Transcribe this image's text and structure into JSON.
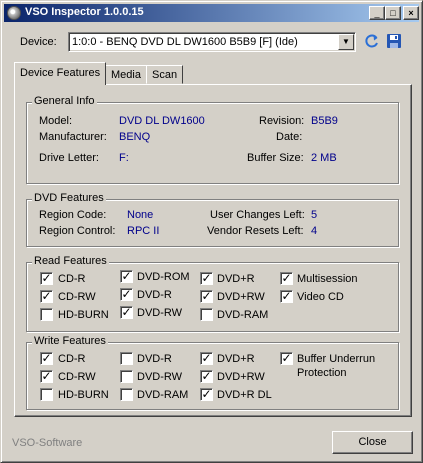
{
  "window": {
    "title": "VSO Inspector 1.0.0.15",
    "minimize_glyph": "_",
    "maximize_glyph": "□",
    "close_glyph": "×"
  },
  "device": {
    "label": "Device:",
    "selected": "1:0:0 - BENQ DVD DL DW1600 B5B9 [F] (Ide)",
    "dropdown_glyph": "▼"
  },
  "tabs": [
    "Device Features",
    "Media",
    "Scan"
  ],
  "general_info": {
    "title": "General Info",
    "model_label": "Model:",
    "model_value": "DVD DL DW1600",
    "revision_label": "Revision:",
    "revision_value": "B5B9",
    "manufacturer_label": "Manufacturer:",
    "manufacturer_value": "BENQ",
    "date_label": "Date:",
    "date_value": "",
    "drive_letter_label": "Drive Letter:",
    "drive_letter_value": "F:",
    "buffer_size_label": "Buffer Size:",
    "buffer_size_value": "2 MB"
  },
  "dvd_features": {
    "title": "DVD Features",
    "region_code_label": "Region Code:",
    "region_code_value": "None",
    "user_changes_label": "User Changes Left:",
    "user_changes_value": "5",
    "region_control_label": "Region Control:",
    "region_control_value": "RPC II",
    "vendor_resets_label": "Vendor Resets Left:",
    "vendor_resets_value": "4"
  },
  "read_features": {
    "title": "Read Features",
    "items": [
      {
        "label": "CD-R",
        "checked": true
      },
      {
        "label": "DVD-ROM",
        "checked": true
      },
      {
        "label": "DVD+R",
        "checked": true
      },
      {
        "label": "Multisession",
        "checked": true
      },
      {
        "label": "CD-RW",
        "checked": true
      },
      {
        "label": "DVD-R",
        "checked": true
      },
      {
        "label": "DVD+RW",
        "checked": true
      },
      {
        "label": "Video CD",
        "checked": true
      },
      {
        "label": "HD-BURN",
        "checked": false
      },
      {
        "label": "DVD-RW",
        "checked": true
      },
      {
        "label": "DVD-RAM",
        "checked": false
      }
    ]
  },
  "write_features": {
    "title": "Write Features",
    "items": [
      {
        "label": "CD-R",
        "checked": true
      },
      {
        "label": "DVD-R",
        "checked": false
      },
      {
        "label": "DVD+R",
        "checked": true
      },
      {
        "label": "Buffer Underrun",
        "label2": "Protection",
        "checked": true
      },
      {
        "label": "CD-RW",
        "checked": true
      },
      {
        "label": "DVD-RW",
        "checked": false
      },
      {
        "label": "DVD+RW",
        "checked": true
      },
      {
        "label": "HD-BURN",
        "checked": false
      },
      {
        "label": "DVD-RAM",
        "checked": false
      },
      {
        "label": "DVD+R DL",
        "checked": true
      }
    ]
  },
  "footer": {
    "brand": "VSO-Software",
    "close_label": "Close"
  },
  "check_glyph": "✓"
}
